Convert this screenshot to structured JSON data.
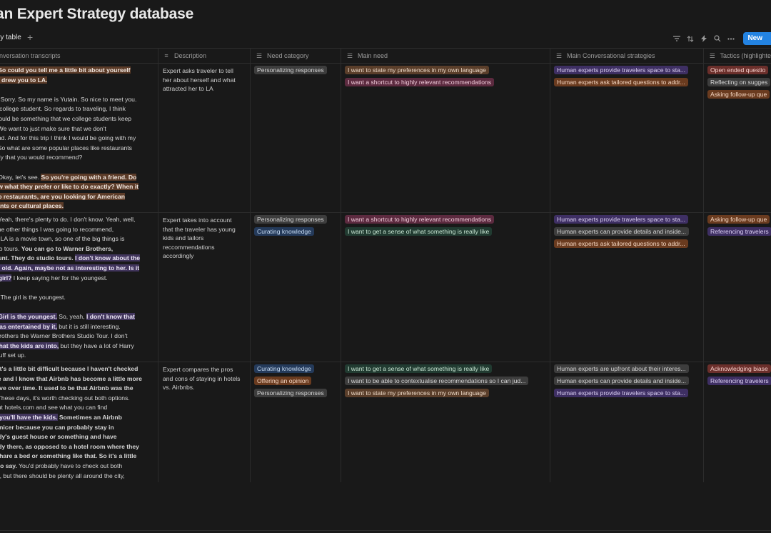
{
  "title": "an Expert Strategy database",
  "view": {
    "tab_label": "ry table",
    "add_symbol": "+"
  },
  "toolbar": {
    "new_label": "New"
  },
  "columns": [
    {
      "label": "onversation transcripts",
      "icon": "text-icon"
    },
    {
      "label": "Description",
      "icon": "text-icon"
    },
    {
      "label": "Need category",
      "icon": "multiselect-icon"
    },
    {
      "label": "Main need",
      "icon": "multiselect-icon"
    },
    {
      "label": "Main Conversational strategies",
      "icon": "multiselect-icon"
    },
    {
      "label": "Tactics (highlighte",
      "icon": "multiselect-icon"
    }
  ],
  "rows": [
    {
      "transcript": [
        [
          {
            "t": ": ",
            "s": "b"
          },
          {
            "t": "So could you tell me a little bit about yourself",
            "s": "o"
          },
          {
            "t": "\n",
            "s": ""
          },
          {
            "t": "at drew you to LA.",
            "s": "o"
          }
        ],
        [
          {
            "t": "r: ",
            "s": "b"
          },
          {
            "t": "Sorry. So my name is Yutain. So nice to meet you.\na college student. So regards to traveling, I think\nwould be something that we college students keep\n. We want to just make sure that we don't\nend. And for this trip I think I would be going with my\n. So what are some popular places like restaurants\nally that you would recommend?",
            "s": ""
          }
        ],
        [
          {
            "t": ": ",
            "s": "b"
          },
          {
            "t": "Okay, let's see. ",
            "s": ""
          },
          {
            "t": "So you're going with a friend. Do",
            "s": "o"
          },
          {
            "t": "\n",
            "s": ""
          },
          {
            "t": "ow what they prefer or like to do exactly? When it",
            "s": "o"
          },
          {
            "t": "\n",
            "s": ""
          },
          {
            "t": " to restaurants, are you looking for American",
            "s": "o"
          },
          {
            "t": "\n",
            "s": ""
          },
          {
            "t": "rants or cultural places.",
            "s": "o"
          }
        ]
      ],
      "description": "Expert asks traveler to tell her about herself and what attracted her to LA",
      "need_category": [
        {
          "label": "Personalizing responses",
          "color": "gray"
        }
      ],
      "main_need": [
        {
          "label": "I want  to state my preferences in my own language",
          "color": "brown"
        },
        {
          "label": "I want a shortcut to highly relevant recommendations",
          "color": "pink"
        }
      ],
      "strategies": [
        {
          "label": "Human experts provide travelers space to sta...",
          "color": "purple"
        },
        {
          "label": "Human experts ask tailored questions to addr...",
          "color": "orange"
        }
      ],
      "tactics": [
        {
          "label": "Open ended questio",
          "color": "red"
        },
        {
          "label": "Reflecting on sugges",
          "color": "gray"
        },
        {
          "label": "Asking follow-up que",
          "color": "orange"
        }
      ]
    },
    {
      "transcript": [
        [
          {
            "t": ": ",
            "s": "b"
          },
          {
            "t": "Yeah, there's plenty to do. I don't know. Yeah, well,\n the other things I was going to recommend,\nly LA is a movie town, so one of the big things is\ndio tours. ",
            "s": ""
          },
          {
            "t": "You can go to Warner Brothers,\nount. They do studio tours. ",
            "s": "b"
          },
          {
            "t": "I don't know about the\nar old. Again, maybe not as interesting to her. Is it\nr girl?",
            "s": "p"
          },
          {
            "t": " I keep saying her for the youngest.",
            "s": ""
          }
        ],
        [
          {
            "t": "r: ",
            "s": "b"
          },
          {
            "t": "The girl is the youngest.",
            "s": ""
          }
        ],
        [
          {
            "t": ": ",
            "s": "b"
          },
          {
            "t": "Girl is the youngest.",
            "s": "p"
          },
          {
            "t": " So, yeah, ",
            "s": ""
          },
          {
            "t": "I don't know that\ne as entertained by it,",
            "s": "p"
          },
          {
            "t": " but it is still interesting.\n brothers the Warner Brothers Studio Tour. I don't\n",
            "s": ""
          },
          {
            "t": "what the kids are into,",
            "s": "p"
          },
          {
            "t": " but they have a lot of Harry\nstuff set up.",
            "s": ""
          }
        ]
      ],
      "description": "Expert takes into account that the traveler has young kids and tailors reccommendations accordingly",
      "need_category": [
        {
          "label": "Personalizing responses",
          "color": "gray"
        },
        {
          "label": "Curating knowledge",
          "color": "blue"
        }
      ],
      "main_need": [
        {
          "label": "I want a shortcut to highly relevant recommendations",
          "color": "pink"
        },
        {
          "label": "I want to get a sense of what something is really like",
          "color": "green"
        }
      ],
      "strategies": [
        {
          "label": "Human experts provide travelers space to sta...",
          "color": "purple"
        },
        {
          "label": "Human experts can provide details and inside...",
          "color": "gray"
        },
        {
          "label": "Human experts ask tailored questions to addr...",
          "color": "orange"
        }
      ],
      "tactics": [
        {
          "label": "Asking follow-up que",
          "color": "orange"
        },
        {
          "label": "Referencing travelers",
          "color": "purple"
        }
      ]
    },
    {
      "transcript": [
        [
          {
            "t": ": ",
            "s": "b"
          },
          {
            "t": "It's a little bit difficult because I haven't checked\nile and I know that Airbnb has become a little more\nsive over time. It used to be that Airbnb was the\n.",
            "s": "b"
          },
          {
            "t": " These days, it's worth checking out both options.\nout hotels.com and see what you can find\ne ",
            "s": ""
          },
          {
            "t": "you'll have the kids.",
            "s": "p"
          },
          {
            "t": " Sometimes an Airbnb\ne nicer because you can probably stay in\nody's guest house or something and have\nody there, as opposed to a hotel room where they\n share a bed or something like that. So it's a little\nt to say.",
            "s": "b"
          },
          {
            "t": " You'd probably have to check out both\nre, but there should be plenty all around the city,",
            "s": ""
          }
        ]
      ],
      "description": "Expert compares the pros and cons of staying in hotels vs. Airbnbs.",
      "need_category": [
        {
          "label": "Curating knowledge",
          "color": "blue"
        },
        {
          "label": "Offering an opinion",
          "color": "orange"
        },
        {
          "label": "Personalizing responses",
          "color": "gray"
        }
      ],
      "main_need": [
        {
          "label": "I want to get a sense of what something is really like",
          "color": "green"
        },
        {
          "label": "I want to be able to contextualise recommendations so I can jud...",
          "color": "gray"
        },
        {
          "label": "I want  to state my preferences in my own language",
          "color": "brown"
        }
      ],
      "strategies": [
        {
          "label": "Human experts are upfront about their interes...",
          "color": "gray"
        },
        {
          "label": "Human experts can provide details and inside...",
          "color": "gray"
        },
        {
          "label": "Human experts provide travelers space to sta...",
          "color": "purple"
        }
      ],
      "tactics": [
        {
          "label": "Acknowledging biase",
          "color": "red"
        },
        {
          "label": "Referencing travelers",
          "color": "purple"
        }
      ]
    }
  ]
}
